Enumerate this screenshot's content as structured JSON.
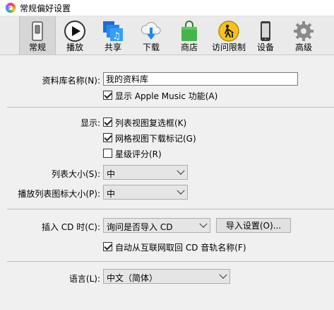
{
  "window": {
    "title": "常规偏好设置"
  },
  "toolbar": {
    "items": [
      {
        "label": "常规",
        "icon": "general-switch-icon",
        "selected": true
      },
      {
        "label": "播放",
        "icon": "play-icon"
      },
      {
        "label": "共享",
        "icon": "sharing-icon"
      },
      {
        "label": "下载",
        "icon": "download-icon"
      },
      {
        "label": "商店",
        "icon": "store-bag-icon"
      },
      {
        "label": "访问限制",
        "icon": "restrictions-icon"
      },
      {
        "label": "设备",
        "icon": "device-icon"
      },
      {
        "label": "高级",
        "icon": "gear-icon"
      }
    ]
  },
  "library": {
    "name_label": "资料库名称(N):",
    "name_value": "我的资料库",
    "show_apple_music": {
      "label": "显示 Apple Music 功能(A)",
      "checked": true
    }
  },
  "display": {
    "label": "显示:",
    "options": [
      {
        "label": "列表视图复选框(K)",
        "checked": true
      },
      {
        "label": "网格视图下载标记(G)",
        "checked": true
      },
      {
        "label": "星级评分(R)",
        "checked": false
      }
    ],
    "list_size_label": "列表大小(S):",
    "list_size_value": "中",
    "playlist_icon_size_label": "播放列表图标大小(P):",
    "playlist_icon_size_value": "中"
  },
  "cd": {
    "insert_label": "插入 CD 时(C):",
    "insert_value": "询问是否导入 CD",
    "import_settings_button": "导入设置(O)...",
    "auto_retrieve": {
      "label": "自动从互联网取回 CD 音轨名称(F)",
      "checked": true
    }
  },
  "language": {
    "label": "语言(L):",
    "value": "中文（简体）"
  }
}
